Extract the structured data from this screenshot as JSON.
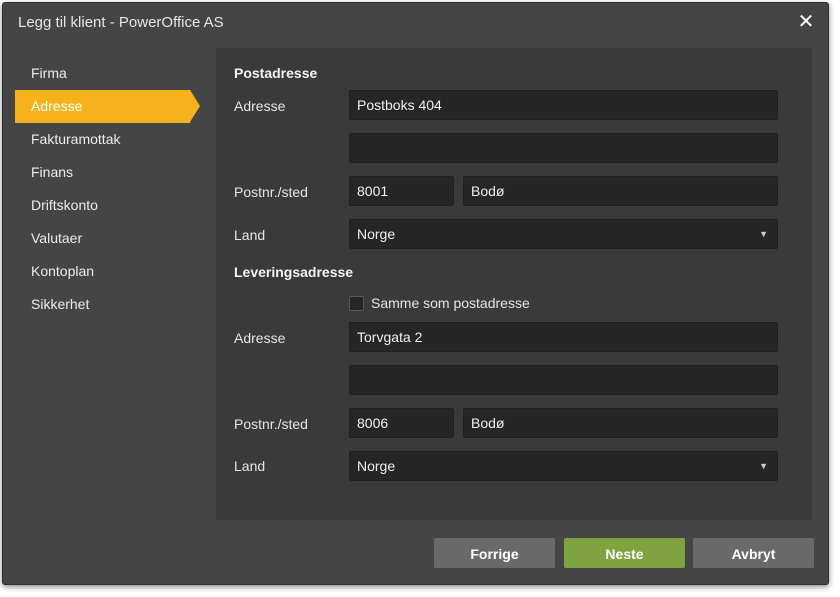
{
  "dialog": {
    "title": "Legg til klient - PowerOffice AS",
    "close_glyph": "✕"
  },
  "nav": {
    "items": [
      {
        "label": "Firma",
        "active": false
      },
      {
        "label": "Adresse",
        "active": true
      },
      {
        "label": "Fakturamottak",
        "active": false
      },
      {
        "label": "Finans",
        "active": false
      },
      {
        "label": "Driftskonto",
        "active": false
      },
      {
        "label": "Valutaer",
        "active": false
      },
      {
        "label": "Kontoplan",
        "active": false
      },
      {
        "label": "Sikkerhet",
        "active": false
      }
    ]
  },
  "postadresse": {
    "heading": "Postadresse",
    "address_label": "Adresse",
    "address_line1": "Postboks 404",
    "address_line2": "",
    "postal_label": "Postnr./sted",
    "postal_code": "8001",
    "city": "Bodø",
    "country_label": "Land",
    "country": "Norge"
  },
  "leveringsadresse": {
    "heading": "Leveringsadresse",
    "same_as_label": "Samme som postadresse",
    "same_as_checked": false,
    "address_label": "Adresse",
    "address_line1": "Torvgata 2",
    "address_line2": "",
    "postal_label": "Postnr./sted",
    "postal_code": "8006",
    "city": "Bodø",
    "country_label": "Land",
    "country": "Norge"
  },
  "buttons": {
    "previous": "Forrige",
    "next": "Neste",
    "cancel": "Avbryt"
  },
  "colors": {
    "accent": "#f5b21b",
    "primary_button": "#7ea33f",
    "secondary_button": "#6a6a6a"
  },
  "icons": {
    "close": "close-icon",
    "dropdown": "caret-down-icon"
  }
}
